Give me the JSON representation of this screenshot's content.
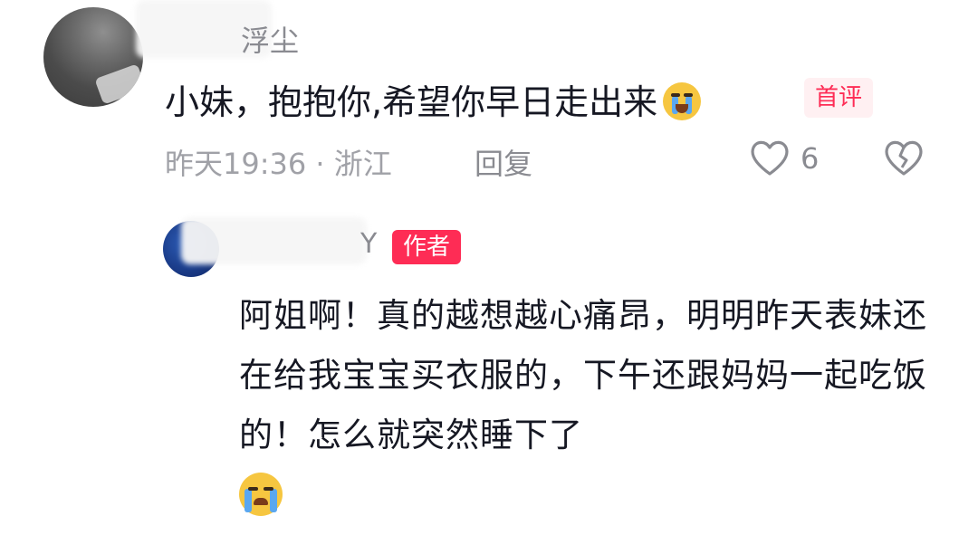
{
  "comment": {
    "username_partial": "浮尘",
    "text": "小妹，抱抱你,希望你早日走出来",
    "emoji": "loudly-crying-face",
    "badge": "首评",
    "meta": "昨天19:36 · 浙江",
    "reply_label": "回复",
    "like_count": "6"
  },
  "reply": {
    "username_partial": "Y",
    "badge": "作者",
    "text": "阿姐啊！真的越想越心痛昂，明明昨天表妹还在给我宝宝买衣服的，下午还跟妈妈一起吃饭的！怎么就突然睡下了",
    "emoji": "sobbing-face"
  },
  "colors": {
    "accent": "#fe2c55",
    "text": "#161823",
    "muted": "#a0a1a7"
  }
}
